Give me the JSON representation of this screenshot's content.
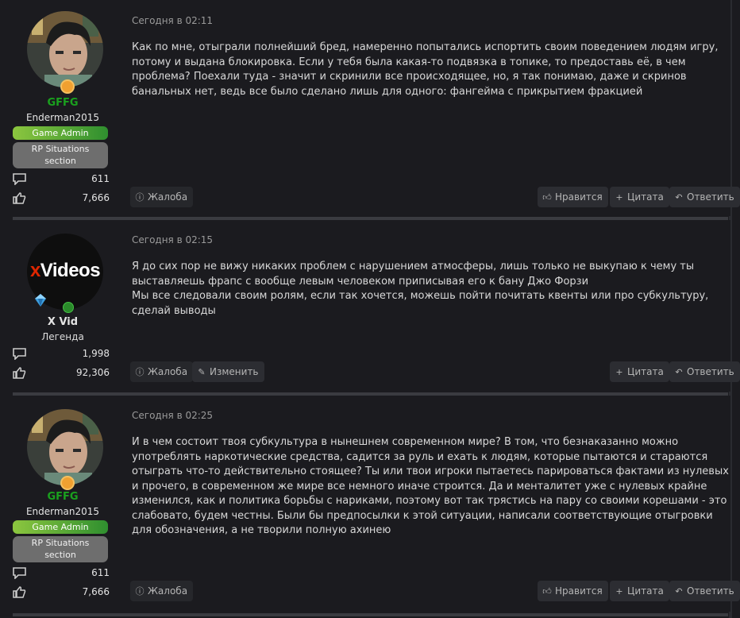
{
  "posts": [
    {
      "date": "Сегодня в 02:11",
      "user_title": "GFFG",
      "username": "Enderman2015",
      "role": "Game Admin",
      "section_badge": "RP Situations section",
      "section_line1": "RP Situations",
      "section_line2": "section",
      "messages_count": "611",
      "reactions_count": "7,666",
      "paragraphs": [
        "Как по мне, отыграли полнейший бред, намеренно попытались испортить своим поведением людям игру, потому и выдана блокировка. Если у тебя была какая-то подвязка в топике, то предоставь её, в чем проблема? Поехали туда - значит и скринили все происходящее, но, я так понимаю, даже и скринов банальных нет, ведь все было сделано лишь для одного: фангейма с прикрытием фракцией"
      ],
      "actions": {
        "report": "Жалоба",
        "like": "Нравится",
        "quote": "Цитата",
        "reply": "Ответить"
      }
    },
    {
      "date": "Сегодня в 02:15",
      "avatar_text_x": "x",
      "avatar_text_rest": "Videos",
      "username": "X Vid",
      "role": "Легенда",
      "messages_count": "1,998",
      "reactions_count": "92,306",
      "paragraphs": [
        "Я до сих пор не вижу никаких проблем с нарушением атмосферы, лишь только не выкупаю к чему ты выставляешь фрапс с вообще левым человеком приписывая его к бану Джо Форзи",
        "Мы все следовали своим ролям, если так хочется, можешь пойти почитать квенты или про субкультуру, сделай выводы"
      ],
      "actions": {
        "report": "Жалоба",
        "edit": "Изменить",
        "quote": "Цитата",
        "reply": "Ответить"
      }
    },
    {
      "date": "Сегодня в 02:25",
      "user_title": "GFFG",
      "username": "Enderman2015",
      "role": "Game Admin",
      "section_line1": "RP Situations",
      "section_line2": "section",
      "messages_count": "611",
      "reactions_count": "7,666",
      "paragraphs": [
        "И в чем состоит твоя субкультура в нынешнем современном мире? В том, что безнаказанно можно употреблять наркотические средства, садится за руль и ехать к людям, которые пытаются и стараются отыграть что-то действительно стоящее? Ты или твои игроки пытаетесь парироваться фактами из нулевых и прочего, в современном же мире все немного иначе строится. Да и менталитет уже с нулевых крайне изменился, как и политика борьбы с нариками, поэтому вот так трястись на пару со своими корешами - это слабовато, будем честны. Были бы предпосылки к этой ситуации, написали соответствующие отыгровки для обозначения, а не творили полную ахинею"
      ],
      "actions": {
        "report": "Жалоба",
        "like": "Нравится",
        "quote": "Цитата",
        "reply": "Ответить"
      }
    }
  ],
  "colors": {
    "background": "#1b1b1f",
    "separator": "#3a3b40",
    "button": "#2c2d32",
    "title_green": "#1aa11e",
    "xvideos_red": "#de2600"
  },
  "icons": [
    "messages-icon",
    "reactions-icon",
    "report-icon",
    "like-icon",
    "quote-icon",
    "reply-icon",
    "edit-icon",
    "trophy-badge-icon",
    "crystal-icon",
    "online-badge-icon"
  ]
}
